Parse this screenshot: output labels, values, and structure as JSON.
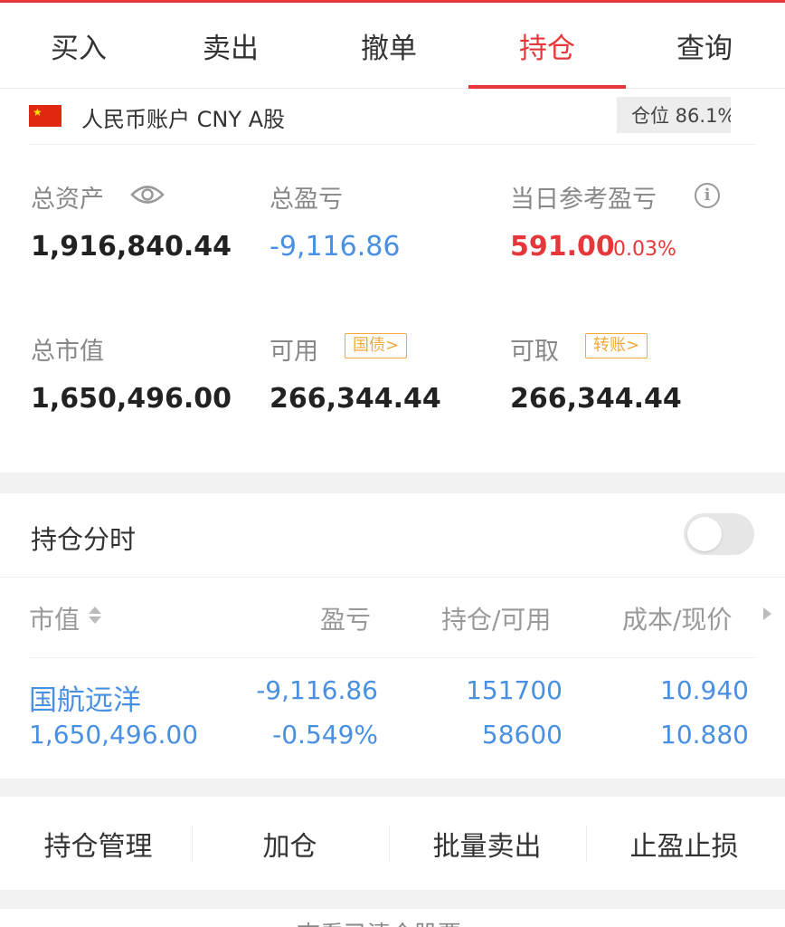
{
  "tabs": [
    {
      "label": "买入"
    },
    {
      "label": "卖出"
    },
    {
      "label": "撤单"
    },
    {
      "label": "持仓",
      "active": true
    },
    {
      "label": "查询"
    }
  ],
  "account": {
    "name": "人民币账户 CNY A股",
    "position_label": "仓位 86.1%",
    "position_ratio": 0.861
  },
  "summary": {
    "total_assets": {
      "label": "总资产",
      "value": "1,916,840.44"
    },
    "total_pnl": {
      "label": "总盈亏",
      "value": "-9,116.86"
    },
    "daily_pnl": {
      "label": "当日参考盈亏",
      "value": "591.00",
      "pct": "0.03%"
    },
    "market_value": {
      "label": "总市值",
      "value": "1,650,496.00"
    },
    "available": {
      "label": "可用",
      "tag": "国债>",
      "value": "266,344.44"
    },
    "withdrawable": {
      "label": "可取",
      "tag": "转账>",
      "value": "266,344.44"
    }
  },
  "holding_chart": {
    "title": "持仓分时",
    "enabled": false
  },
  "table": {
    "headers": [
      "市值",
      "盈亏",
      "持仓/可用",
      "成本/现价"
    ],
    "rows": [
      {
        "name": "国航远洋",
        "market_value": "1,650,496.00",
        "pnl": "-9,116.86",
        "pnl_pct": "-0.549%",
        "position": "151700",
        "available": "58600",
        "cost": "10.940",
        "price": "10.880"
      }
    ]
  },
  "actions": [
    {
      "label": "持仓管理"
    },
    {
      "label": "加仓"
    },
    {
      "label": "批量卖出"
    },
    {
      "label": "止盈止损"
    }
  ],
  "more": {
    "label": "查看已清仓股票 >"
  },
  "colors": {
    "accent": "#e6383a",
    "link_blue": "#4a90e2",
    "tag_orange": "#f2a93b"
  }
}
